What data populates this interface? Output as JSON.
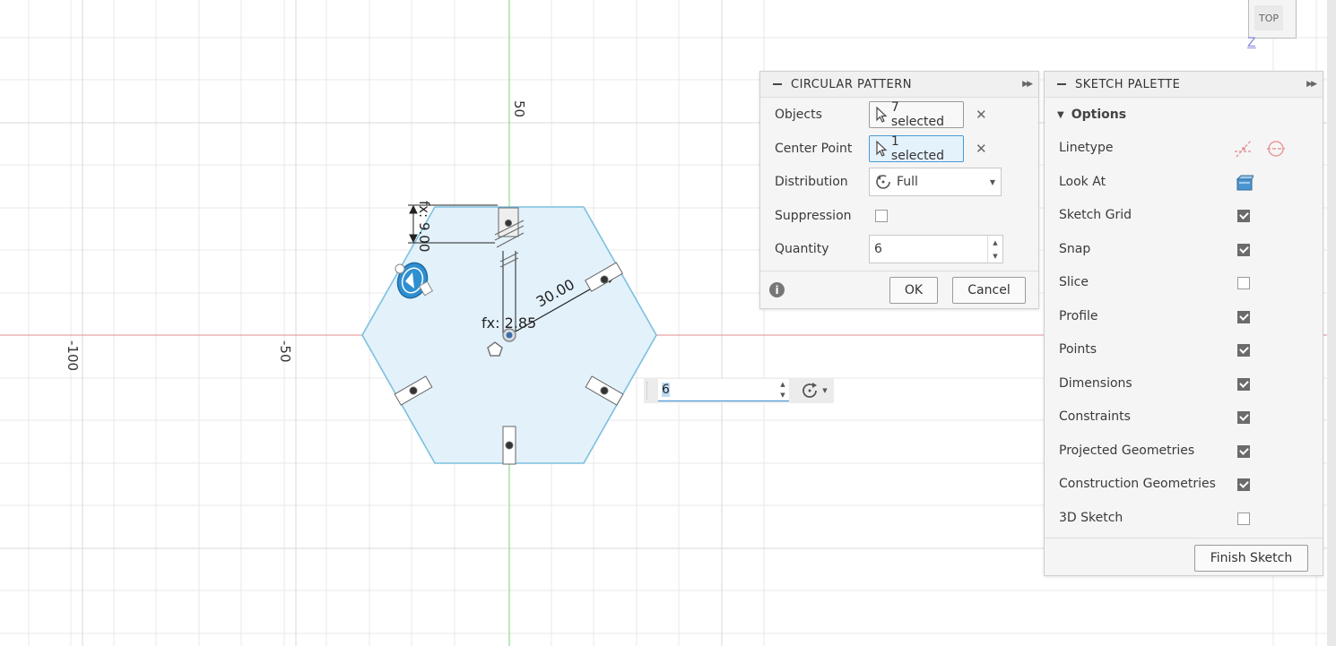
{
  "viewcube": {
    "face_label": "TOP",
    "axis_label": "Z"
  },
  "canvas": {
    "ruler_labels": {
      "v50": "50",
      "hm100": "-100",
      "hm50": "-50"
    },
    "dimensions": {
      "height": "fx: 9.00",
      "radius": "30.00",
      "angle": "fx: 2.85"
    },
    "inline_quantity": "6"
  },
  "circular_pattern": {
    "title": "CIRCULAR PATTERN",
    "objects_label": "Objects",
    "objects_value": "7 selected",
    "center_label": "Center Point",
    "center_value": "1 selected",
    "distribution_label": "Distribution",
    "distribution_value": "Full",
    "suppression_label": "Suppression",
    "quantity_label": "Quantity",
    "quantity_value": "6",
    "ok_label": "OK",
    "cancel_label": "Cancel"
  },
  "sketch_palette": {
    "title": "SKETCH PALETTE",
    "section": "Options",
    "linetype_label": "Linetype",
    "lookat_label": "Look At",
    "options": [
      {
        "label": "Sketch Grid",
        "checked": true
      },
      {
        "label": "Snap",
        "checked": true
      },
      {
        "label": "Slice",
        "checked": false
      },
      {
        "label": "Profile",
        "checked": true
      },
      {
        "label": "Points",
        "checked": true
      },
      {
        "label": "Dimensions",
        "checked": true
      },
      {
        "label": "Constraints",
        "checked": true
      },
      {
        "label": "Projected Geometries",
        "checked": true
      },
      {
        "label": "Construction Geometries",
        "checked": true
      },
      {
        "label": "3D Sketch",
        "checked": false
      }
    ],
    "finish_label": "Finish Sketch"
  },
  "colors": {
    "sketch_line": "#7cc0de",
    "sketch_fill": "#e3f1fa",
    "x_axis": "#e6a3a3",
    "y_axis": "#8fdc8f",
    "grid": "#e6e6e6"
  }
}
